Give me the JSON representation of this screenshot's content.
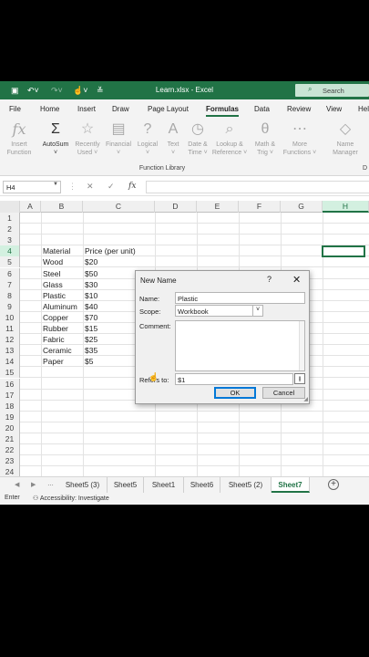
{
  "titlebar": {
    "title": "Learn.xlsx - Excel",
    "search_placeholder": "Search"
  },
  "ribbon_tabs": [
    "File",
    "Home",
    "Insert",
    "Draw",
    "Page Layout",
    "Formulas",
    "Data",
    "Review",
    "View",
    "Hel"
  ],
  "ribbon_active_tab": "Formulas",
  "ribbon": {
    "insert_function": [
      "Insert",
      "Function"
    ],
    "autosum": "AutoSum",
    "recently_used": [
      "Recently",
      "Used ˅"
    ],
    "financial": "Financial",
    "logical": "Logical",
    "text": "Text",
    "date_time": [
      "Date &",
      "Time ˅"
    ],
    "lookup_reference": [
      "Lookup &",
      "Reference ˅"
    ],
    "math_trig": [
      "Math &",
      "Trig ˅"
    ],
    "more_functions": [
      "More",
      "Functions ˅"
    ],
    "name_manager": [
      "Name",
      "Manager"
    ],
    "group_label": "Function Library",
    "group_label_2": "D"
  },
  "formula_bar": {
    "name_box": "H4",
    "cancel": "✕",
    "enter": "✓",
    "fx": "fx",
    "value": ""
  },
  "columns": [
    "A",
    "B",
    "C",
    "D",
    "E",
    "F",
    "G",
    "H"
  ],
  "selected_column": "H",
  "rows": [
    "1",
    "2",
    "3",
    "4",
    "5",
    "6",
    "7",
    "8",
    "9",
    "10",
    "11",
    "12",
    "13",
    "14",
    "15",
    "16",
    "17",
    "18",
    "19",
    "20",
    "21",
    "22",
    "23",
    "24"
  ],
  "selected_row": "4",
  "table": {
    "header_b": "Material",
    "header_c": "Price (per unit)",
    "materials": [
      "Wood",
      "Steel",
      "Glass",
      "Plastic",
      "Aluminum",
      "Copper",
      "Rubber",
      "Fabric",
      "Ceramic",
      "Paper"
    ],
    "prices": [
      "$20",
      "$50",
      "$30",
      "$10",
      "$40",
      "$70",
      "$15",
      "$25",
      "$35",
      "$5"
    ]
  },
  "sheet_tabs": [
    "Sheet5 (3)",
    "Sheet5",
    "Sheet1",
    "Sheet6",
    "Sheet5 (2)",
    "Sheet7"
  ],
  "active_sheet": "Sheet7",
  "status": {
    "ready": "Enter",
    "accessibility": "Accessibility: Investigate"
  },
  "dialog": {
    "title": "New Name",
    "help": "?",
    "close": "✕",
    "name_label": "Name:",
    "name_value": "Plastic",
    "scope_label": "Scope:",
    "scope_value": "Workbook",
    "comment_label": "Comment:",
    "comment_value": "",
    "refers_label": "Refers to:",
    "refers_value": "$1",
    "ok": "OK",
    "cancel": "Cancel"
  },
  "colors": {
    "excel_green": "#217346",
    "selection_fill": "#d3f0e0",
    "dialog_bg": "#f0f0f0"
  }
}
